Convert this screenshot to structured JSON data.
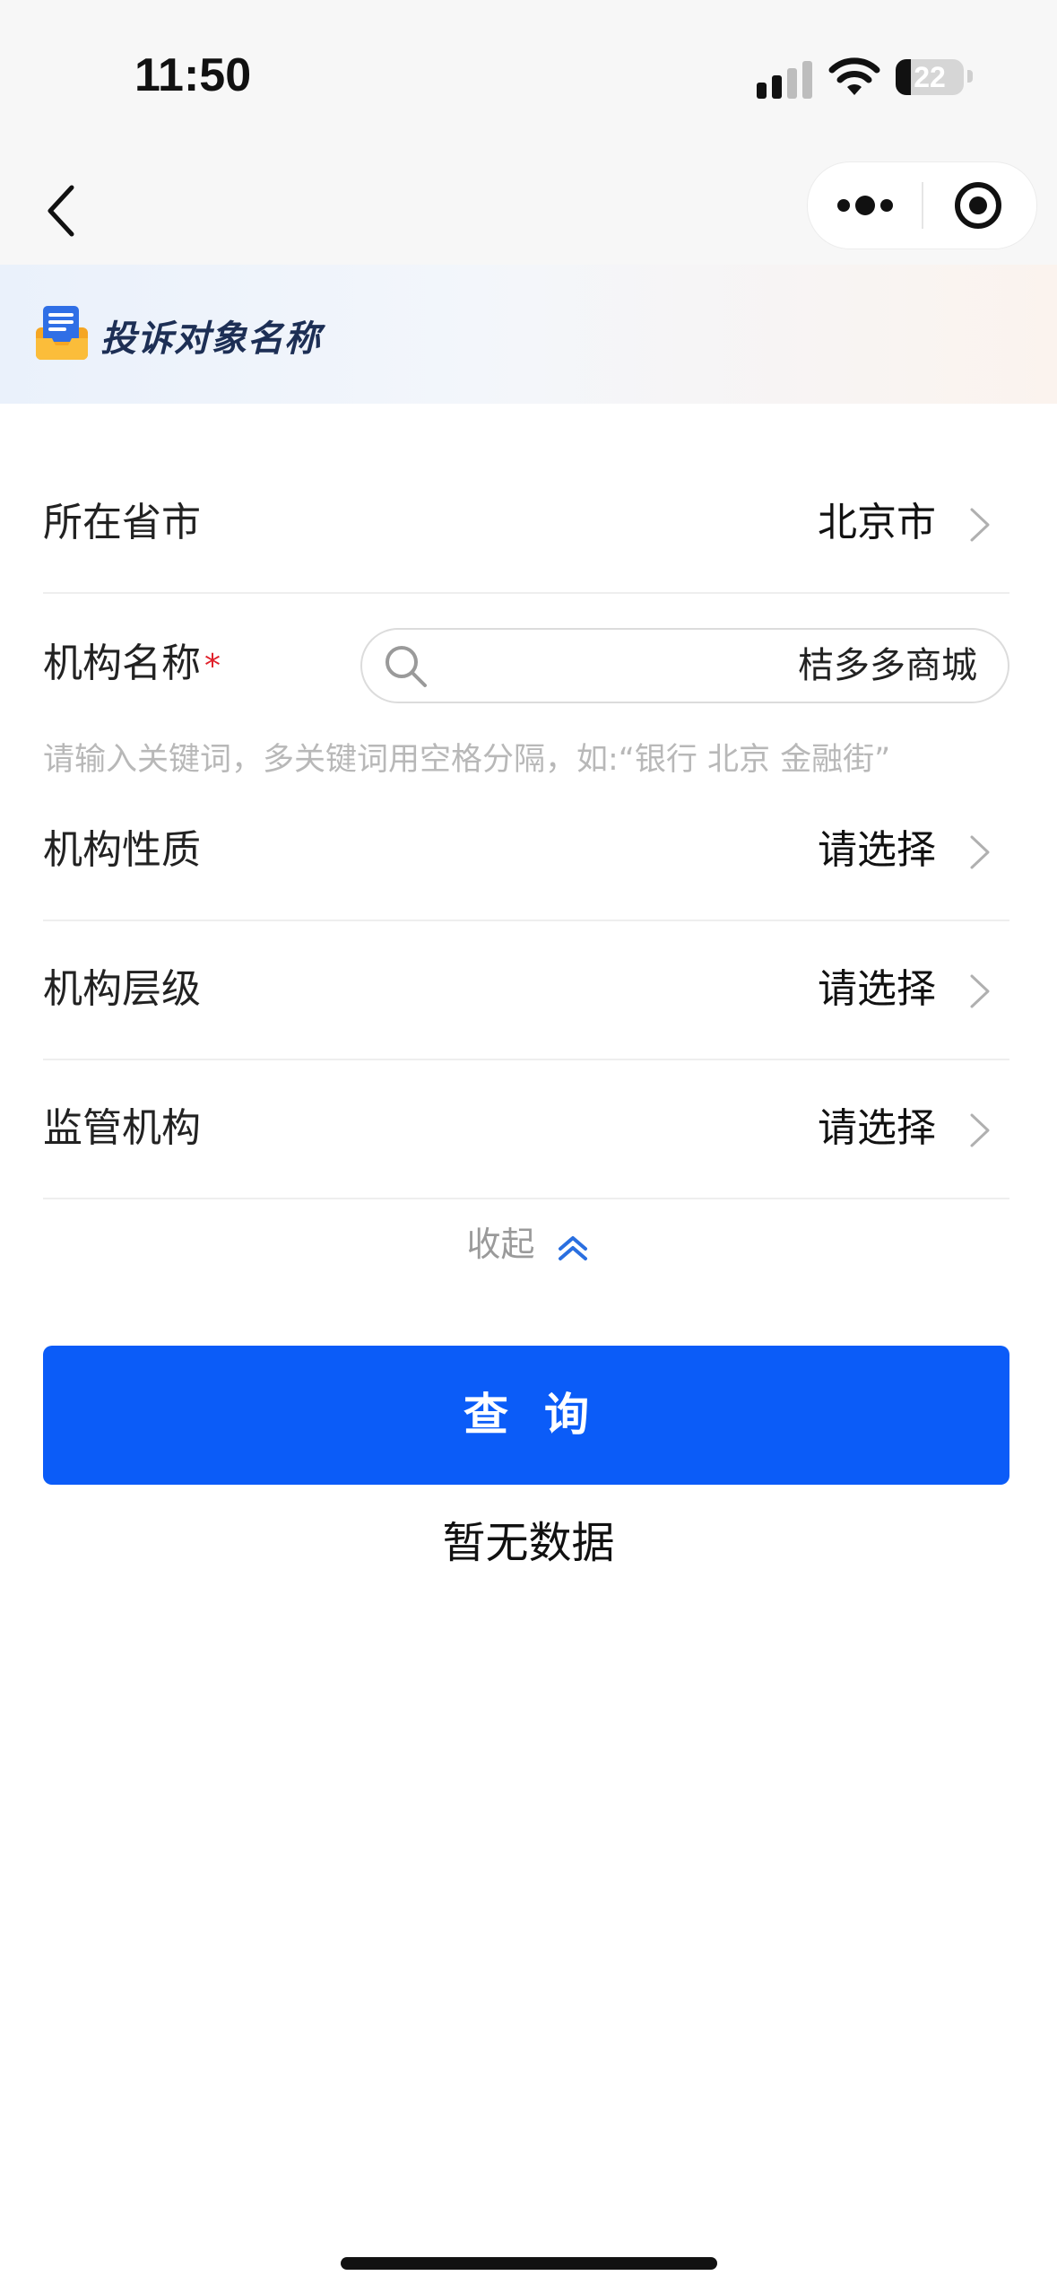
{
  "status_bar": {
    "time": "11:50",
    "battery": "22",
    "battery_level": 0.22
  },
  "banner": {
    "title": "投诉对象名称"
  },
  "form": {
    "province_city": {
      "label": "所在省市",
      "value": "北京市"
    },
    "institution_name": {
      "label": "机构名称",
      "required_mark": "*",
      "value": "桔多多商城",
      "hint": "请输入关键词，多关键词用空格分隔，如:“银行 北京 金融街”"
    },
    "institution_nature": {
      "label": "机构性质",
      "value": "请选择"
    },
    "institution_level": {
      "label": "机构层级",
      "value": "请选择"
    },
    "regulator": {
      "label": "监管机构",
      "value": "请选择"
    },
    "collapse_label": "收起"
  },
  "query_button": "查询",
  "empty_message": "暂无数据",
  "colors": {
    "primary": "#0b5cf8",
    "required": "#e0202a",
    "hint": "#b8b8b8",
    "collapse_icon": "#2a6fe0"
  },
  "icons": {
    "back": "chevron-left-icon",
    "more": "more-dots-icon",
    "close": "target-circle-icon",
    "banner": "document-tray-icon",
    "search": "search-icon",
    "row_arrow": "chevron-right-icon",
    "collapse": "double-chevron-up-icon"
  }
}
